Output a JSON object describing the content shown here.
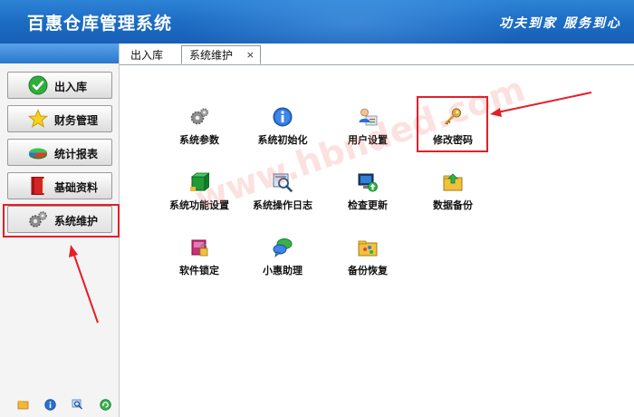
{
  "app": {
    "title": "百惠仓库管理系统",
    "slogan": "功夫到家 服务到心"
  },
  "sidebar": {
    "items": [
      {
        "label": "出入库",
        "icon": "green-check-icon"
      },
      {
        "label": "财务管理",
        "icon": "star-icon"
      },
      {
        "label": "统计报表",
        "icon": "pie-chart-icon"
      },
      {
        "label": "基础资料",
        "icon": "red-book-icon"
      },
      {
        "label": "系统维护",
        "icon": "gears-icon",
        "selected": true
      }
    ],
    "bottom_icons": [
      "folder-icon",
      "info-icon",
      "search-icon",
      "refresh-icon"
    ]
  },
  "tabs": [
    {
      "label": "出入库",
      "active": false
    },
    {
      "label": "系统维护",
      "active": true,
      "close": "×"
    }
  ],
  "tiles": [
    {
      "label": "系统参数",
      "icon": "gears-icon"
    },
    {
      "label": "系统初始化",
      "icon": "info-icon"
    },
    {
      "label": "用户设置",
      "icon": "user-settings-icon"
    },
    {
      "label": "修改密码",
      "icon": "key-icon"
    },
    {
      "label": "系统功能设置",
      "icon": "green-box-icon"
    },
    {
      "label": "系统操作日志",
      "icon": "magnifier-log-icon"
    },
    {
      "label": "检查更新",
      "icon": "monitor-update-icon"
    },
    {
      "label": "数据备份",
      "icon": "folder-save-icon"
    },
    {
      "label": "软件锁定",
      "icon": "lock-box-icon"
    },
    {
      "label": "小惠助理",
      "icon": "chat-icon"
    },
    {
      "label": "备份恢复",
      "icon": "folder-restore-icon"
    }
  ],
  "watermark": "www.hbnded.com",
  "colors": {
    "header": "#1d6cc4",
    "annotation": "#e41f28",
    "sidebar_bar": "#2a78cf"
  }
}
